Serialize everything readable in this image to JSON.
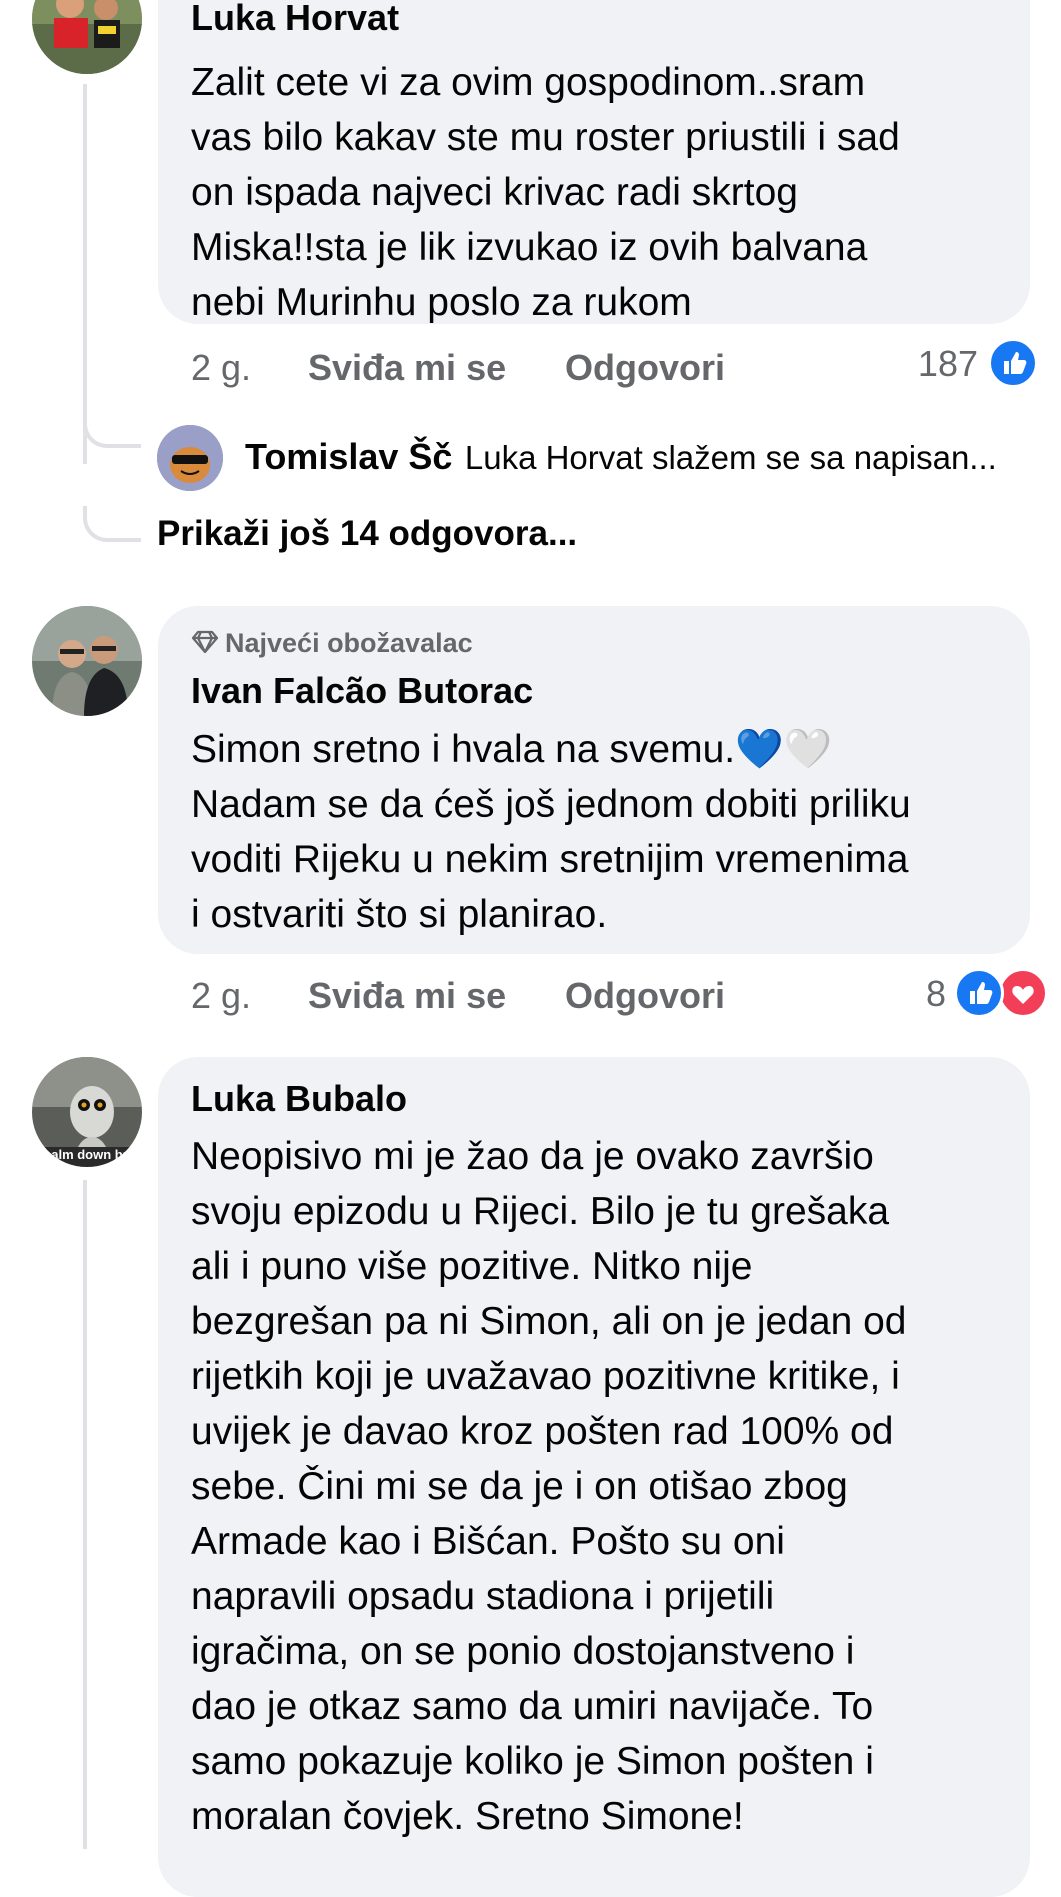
{
  "comments": [
    {
      "author": "Luka Horvat",
      "text": "Zalit cete vi za ovim gospodinom..sram\nvas bilo kakav ste mu roster priustili i sad\non ispada najveci krivac radi skrtog\nMiska!!sta je lik izvukao iz ovih balvana\nnebi Murinhu poslo za rukom",
      "time": "2 g.",
      "like_label": "Sviđa mi se",
      "reply_label": "Odgovori",
      "reaction_count": "187",
      "reactions": [
        "like-icon"
      ]
    },
    {
      "badge": "Najveći obožavalac",
      "badge_icon": "diamond-icon",
      "author": "Ivan Falcão Butorac",
      "text": "Simon sretno i hvala na svemu.💙🤍\nNadam se da ćeš još jednom dobiti priliku\nvoditi Rijeku u nekim sretnijim vremenima\ni  ostvariti što si planirao.",
      "time": "2 g.",
      "like_label": "Sviđa mi se",
      "reply_label": "Odgovori",
      "reaction_count": "8",
      "reactions": [
        "like-icon",
        "heart-icon"
      ]
    },
    {
      "author": "Luka Bubalo",
      "text": "Neopisivo mi je žao da je ovako završio\nsvoju epizodu u Rijeci.  Bilo je tu grešaka\nali i puno više pozitive. Nitko nije\nbezgrešan pa ni Simon, ali on je jedan od\nrijetkih koji je uvažavao pozitivne kritike, i\nuvijek je davao kroz pošten rad 100% od\nsebe. Čini mi se da je i on otišao zbog\nArmade kao i Bišćan. Pošto su oni\nnapravili opsadu stadiona i prijetili\nigračima, on se ponio dostojanstveno i\ndao je otkaz samo da umiri navijače. To\nsamo pokazuje koliko je Simon pošten i\nmoralan čovjek. Sretno Simone!"
    }
  ],
  "reply_preview": {
    "author": "Tomislav Šč",
    "text": "Luka Horvat slažem se sa napisan..."
  },
  "more_replies_label": "Prikaži još 14 odgovora...",
  "avatar3_caption": "calm down bro",
  "colors": {
    "bubble": "#f0f2f5",
    "like_blue": "#1877f2",
    "heart_red": "#f33e58",
    "muted": "#65676b"
  }
}
